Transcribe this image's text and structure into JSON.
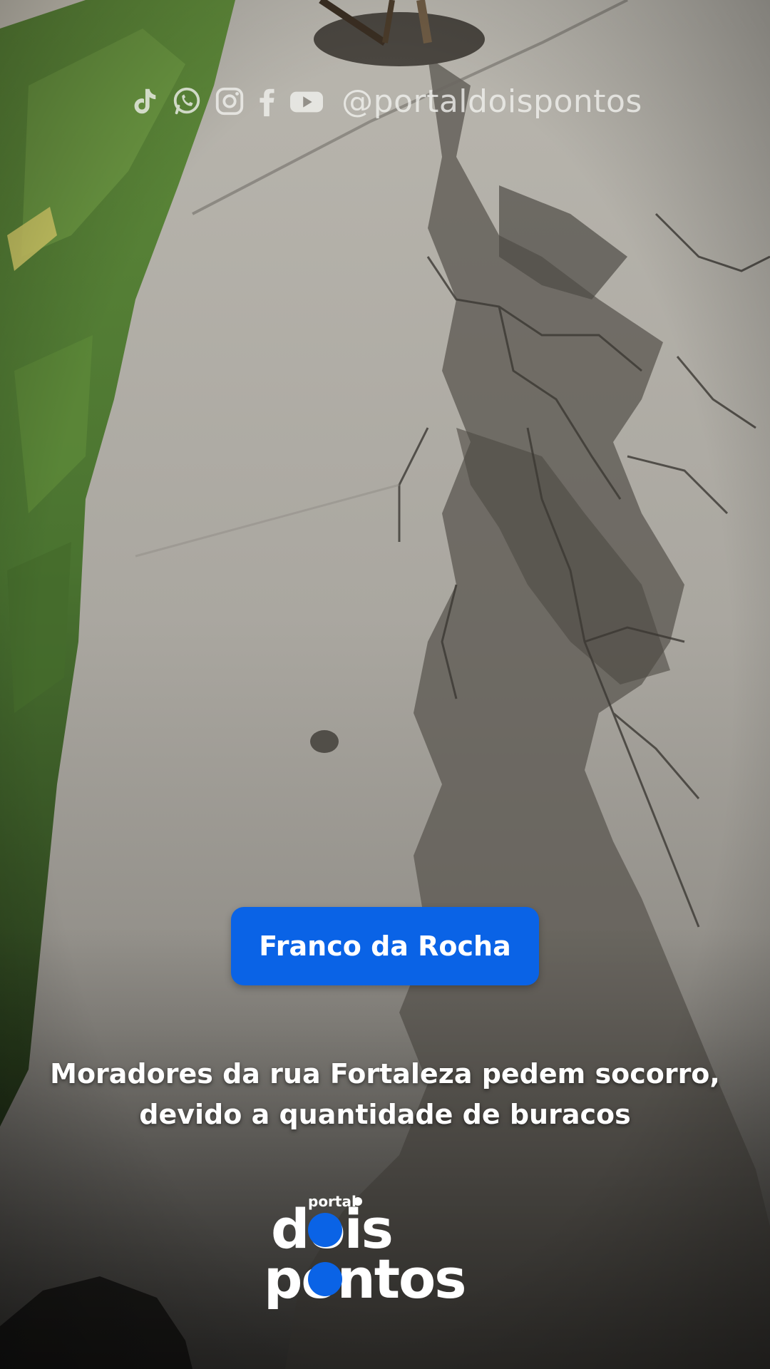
{
  "social": {
    "icons": [
      "tiktok-icon",
      "whatsapp-icon",
      "instagram-icon",
      "facebook-icon",
      "youtube-icon"
    ],
    "handle": "@portaldoispontos"
  },
  "badge": {
    "text": "Franco da Rocha",
    "color": "#0a63e6"
  },
  "headline": {
    "line1": "Moradores da rua Fortaleza pedem socorro,",
    "line2": "devido a quantidade de buracos"
  },
  "logo": {
    "small": "portal",
    "word1": "dois",
    "word2": "pontos",
    "accent": "#0a63e6"
  }
}
